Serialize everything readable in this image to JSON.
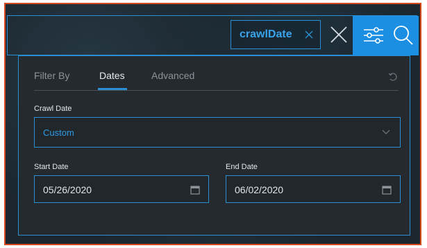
{
  "search_bar": {
    "filter_chip": {
      "label": "crawlDate"
    }
  },
  "filter_panel": {
    "tabs": [
      {
        "label": "Filter By",
        "active": false
      },
      {
        "label": "Dates",
        "active": true
      },
      {
        "label": "Advanced",
        "active": false
      }
    ],
    "crawl_date": {
      "label": "Crawl Date",
      "selected": "Custom"
    },
    "start_date": {
      "label": "Start Date",
      "value": "05/26/2020"
    },
    "end_date": {
      "label": "End Date",
      "value": "06/02/2020"
    }
  },
  "colors": {
    "accent": "#2a8fd3",
    "active_button": "#1c8fe3",
    "frame_border": "#d64a1e",
    "panel_bg": "#252a2e"
  },
  "icons": [
    "close-icon",
    "filter-sliders-icon",
    "search-icon",
    "reset-icon",
    "chevron-down-icon",
    "calendar-icon"
  ]
}
